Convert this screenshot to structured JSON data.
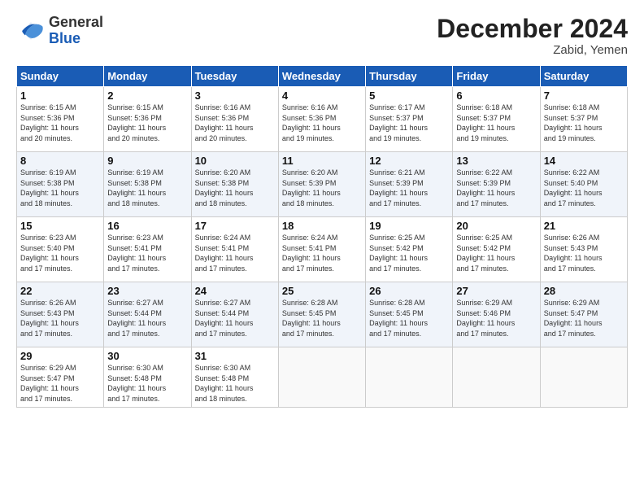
{
  "header": {
    "logo": {
      "general": "General",
      "blue": "Blue"
    },
    "title": "December 2024",
    "location": "Zabid, Yemen"
  },
  "weekdays": [
    "Sunday",
    "Monday",
    "Tuesday",
    "Wednesday",
    "Thursday",
    "Friday",
    "Saturday"
  ],
  "weeks": [
    [
      {
        "day": "1",
        "info": "Sunrise: 6:15 AM\nSunset: 5:36 PM\nDaylight: 11 hours\nand 20 minutes."
      },
      {
        "day": "2",
        "info": "Sunrise: 6:15 AM\nSunset: 5:36 PM\nDaylight: 11 hours\nand 20 minutes."
      },
      {
        "day": "3",
        "info": "Sunrise: 6:16 AM\nSunset: 5:36 PM\nDaylight: 11 hours\nand 20 minutes."
      },
      {
        "day": "4",
        "info": "Sunrise: 6:16 AM\nSunset: 5:36 PM\nDaylight: 11 hours\nand 19 minutes."
      },
      {
        "day": "5",
        "info": "Sunrise: 6:17 AM\nSunset: 5:37 PM\nDaylight: 11 hours\nand 19 minutes."
      },
      {
        "day": "6",
        "info": "Sunrise: 6:18 AM\nSunset: 5:37 PM\nDaylight: 11 hours\nand 19 minutes."
      },
      {
        "day": "7",
        "info": "Sunrise: 6:18 AM\nSunset: 5:37 PM\nDaylight: 11 hours\nand 19 minutes."
      }
    ],
    [
      {
        "day": "8",
        "info": "Sunrise: 6:19 AM\nSunset: 5:38 PM\nDaylight: 11 hours\nand 18 minutes."
      },
      {
        "day": "9",
        "info": "Sunrise: 6:19 AM\nSunset: 5:38 PM\nDaylight: 11 hours\nand 18 minutes."
      },
      {
        "day": "10",
        "info": "Sunrise: 6:20 AM\nSunset: 5:38 PM\nDaylight: 11 hours\nand 18 minutes."
      },
      {
        "day": "11",
        "info": "Sunrise: 6:20 AM\nSunset: 5:39 PM\nDaylight: 11 hours\nand 18 minutes."
      },
      {
        "day": "12",
        "info": "Sunrise: 6:21 AM\nSunset: 5:39 PM\nDaylight: 11 hours\nand 17 minutes."
      },
      {
        "day": "13",
        "info": "Sunrise: 6:22 AM\nSunset: 5:39 PM\nDaylight: 11 hours\nand 17 minutes."
      },
      {
        "day": "14",
        "info": "Sunrise: 6:22 AM\nSunset: 5:40 PM\nDaylight: 11 hours\nand 17 minutes."
      }
    ],
    [
      {
        "day": "15",
        "info": "Sunrise: 6:23 AM\nSunset: 5:40 PM\nDaylight: 11 hours\nand 17 minutes."
      },
      {
        "day": "16",
        "info": "Sunrise: 6:23 AM\nSunset: 5:41 PM\nDaylight: 11 hours\nand 17 minutes."
      },
      {
        "day": "17",
        "info": "Sunrise: 6:24 AM\nSunset: 5:41 PM\nDaylight: 11 hours\nand 17 minutes."
      },
      {
        "day": "18",
        "info": "Sunrise: 6:24 AM\nSunset: 5:41 PM\nDaylight: 11 hours\nand 17 minutes."
      },
      {
        "day": "19",
        "info": "Sunrise: 6:25 AM\nSunset: 5:42 PM\nDaylight: 11 hours\nand 17 minutes."
      },
      {
        "day": "20",
        "info": "Sunrise: 6:25 AM\nSunset: 5:42 PM\nDaylight: 11 hours\nand 17 minutes."
      },
      {
        "day": "21",
        "info": "Sunrise: 6:26 AM\nSunset: 5:43 PM\nDaylight: 11 hours\nand 17 minutes."
      }
    ],
    [
      {
        "day": "22",
        "info": "Sunrise: 6:26 AM\nSunset: 5:43 PM\nDaylight: 11 hours\nand 17 minutes."
      },
      {
        "day": "23",
        "info": "Sunrise: 6:27 AM\nSunset: 5:44 PM\nDaylight: 11 hours\nand 17 minutes."
      },
      {
        "day": "24",
        "info": "Sunrise: 6:27 AM\nSunset: 5:44 PM\nDaylight: 11 hours\nand 17 minutes."
      },
      {
        "day": "25",
        "info": "Sunrise: 6:28 AM\nSunset: 5:45 PM\nDaylight: 11 hours\nand 17 minutes."
      },
      {
        "day": "26",
        "info": "Sunrise: 6:28 AM\nSunset: 5:45 PM\nDaylight: 11 hours\nand 17 minutes."
      },
      {
        "day": "27",
        "info": "Sunrise: 6:29 AM\nSunset: 5:46 PM\nDaylight: 11 hours\nand 17 minutes."
      },
      {
        "day": "28",
        "info": "Sunrise: 6:29 AM\nSunset: 5:47 PM\nDaylight: 11 hours\nand 17 minutes."
      }
    ],
    [
      {
        "day": "29",
        "info": "Sunrise: 6:29 AM\nSunset: 5:47 PM\nDaylight: 11 hours\nand 17 minutes."
      },
      {
        "day": "30",
        "info": "Sunrise: 6:30 AM\nSunset: 5:48 PM\nDaylight: 11 hours\nand 17 minutes."
      },
      {
        "day": "31",
        "info": "Sunrise: 6:30 AM\nSunset: 5:48 PM\nDaylight: 11 hours\nand 18 minutes."
      },
      {
        "day": "",
        "info": ""
      },
      {
        "day": "",
        "info": ""
      },
      {
        "day": "",
        "info": ""
      },
      {
        "day": "",
        "info": ""
      }
    ]
  ]
}
